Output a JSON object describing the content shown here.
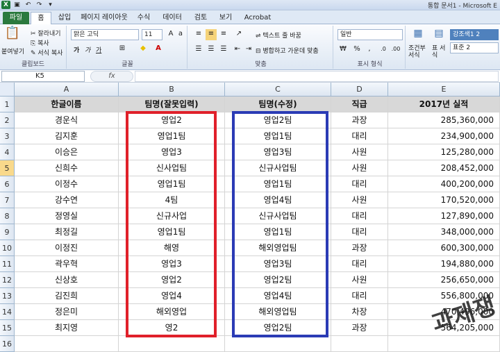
{
  "window": {
    "title": "통합 문서1 - Microsoft E",
    "app_icon": "X"
  },
  "tabs": [
    "파일",
    "홈",
    "삽입",
    "페이지 레이아웃",
    "수식",
    "데이터",
    "검토",
    "보기",
    "Acrobat"
  ],
  "ribbon": {
    "clipboard": {
      "paste": "붙여넣기",
      "cut": "잘라내기",
      "copy": "복사",
      "format_painter": "서식 복사",
      "label": "클립보드"
    },
    "font": {
      "name": "맑은 고딕",
      "size": "11",
      "bold": "가",
      "italic": "가",
      "underline": "가",
      "label": "글꼴"
    },
    "alignment": {
      "wrap": "텍스트 줄 바꿈",
      "merge": "병합하고 가운데 맞춤",
      "label": "맞춤"
    },
    "number": {
      "format": "일반",
      "label": "표시 형식"
    },
    "styles": {
      "conditional": "조건부 서식",
      "table": "표 서식",
      "style1": "강조색1 2",
      "style2": "표준 2"
    }
  },
  "formula_bar": {
    "name_box": "K5",
    "fx": "fx",
    "value": ""
  },
  "columns": [
    "A",
    "B",
    "C",
    "D",
    "E"
  ],
  "selected_row": "5",
  "sheet": {
    "headers": [
      "한글이름",
      "팀명(잘못입력)",
      "팀명(수정)",
      "직급",
      "2017년 실적"
    ],
    "rows": [
      [
        "경운식",
        "영업2",
        "영업2팀",
        "과장",
        "285,360,000"
      ],
      [
        "김지훈",
        "영업1팀",
        "영업1팀",
        "대리",
        "234,900,000"
      ],
      [
        "이승은",
        "영업3",
        "영업3팀",
        "사원",
        "125,280,000"
      ],
      [
        "신희수",
        "신사업팀",
        "신규사업팀",
        "사원",
        "208,452,000"
      ],
      [
        "이정수",
        "영업1팀",
        "영업1팀",
        "대리",
        "400,200,000"
      ],
      [
        "강수연",
        "4팀",
        "영업4팀",
        "사원",
        "170,520,000"
      ],
      [
        "정영실",
        "신규사업",
        "신규사업팀",
        "대리",
        "127,890,000"
      ],
      [
        "최정길",
        "영업1팀",
        "영업1팀",
        "대리",
        "348,000,000"
      ],
      [
        "이정진",
        "해영",
        "해외영업팀",
        "과장",
        "600,300,000"
      ],
      [
        "곽우혁",
        "영업3",
        "영업3팀",
        "대리",
        "194,880,000"
      ],
      [
        "신상호",
        "영업2",
        "영업2팀",
        "사원",
        "256,650,000"
      ],
      [
        "김진희",
        "영업4",
        "영업4팀",
        "대리",
        "556,800,000"
      ],
      [
        "정은미",
        "해외영업",
        "해외영업팀",
        "차장",
        "470,496,000"
      ],
      [
        "최지영",
        "영2",
        "영업2팀",
        "과장",
        "564,205,000"
      ]
    ],
    "row_numbers": [
      "1",
      "2",
      "3",
      "4",
      "5",
      "6",
      "7",
      "8",
      "9",
      "10",
      "11",
      "12",
      "13",
      "14",
      "15",
      "16"
    ]
  },
  "highlight_colors": {
    "wrong": "#e0202a",
    "fixed": "#2b3bb5"
  },
  "watermark": "과제쟁"
}
